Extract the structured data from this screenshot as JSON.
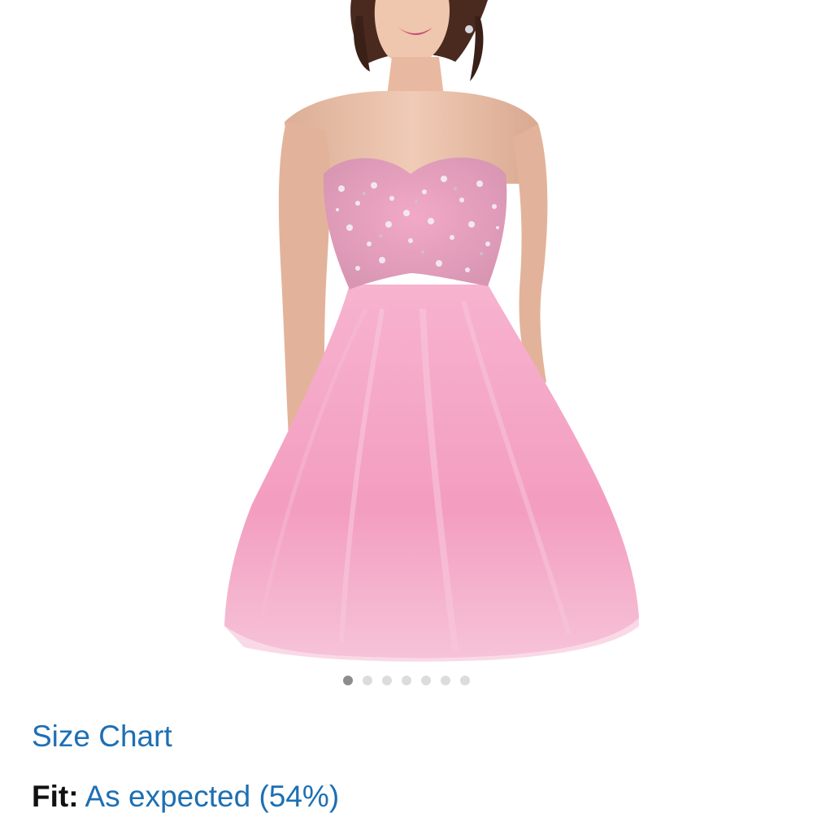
{
  "product": {
    "image_alt": "Pink strapless sweetheart beaded tulle short dress",
    "image_count": 7,
    "active_image_index": 0
  },
  "size_chart": {
    "label": "Size Chart"
  },
  "fit": {
    "label": "Fit:",
    "value": "As expected (54%)"
  },
  "colors": {
    "link": "#1e6fb3",
    "dot_active": "#8d8d8d",
    "dot_inactive": "#dcdcdc",
    "dress_pink": "#f4a6c7"
  }
}
